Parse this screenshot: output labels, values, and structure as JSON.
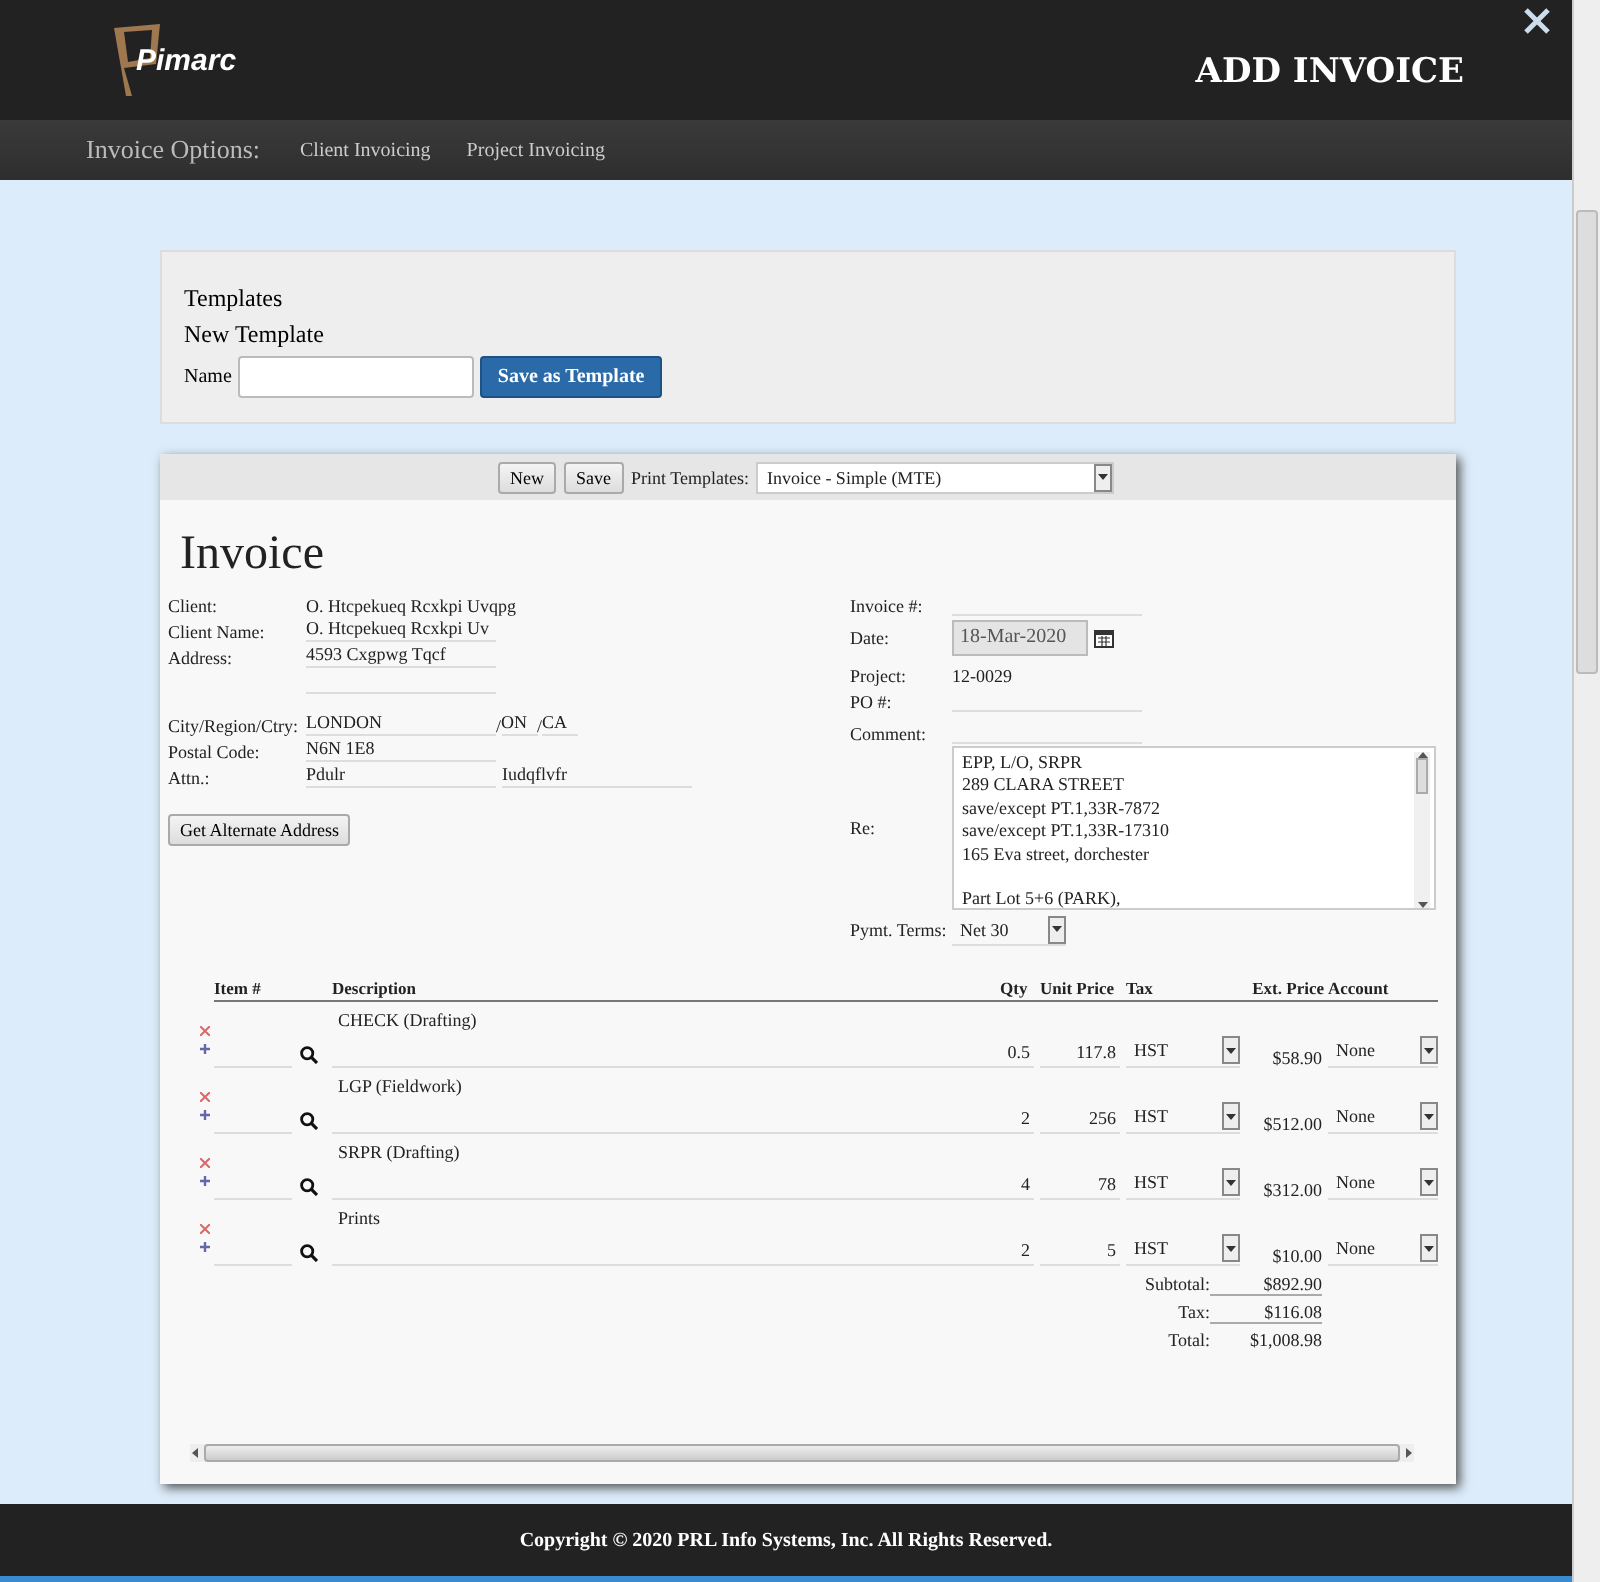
{
  "header": {
    "logo_text": "Pimarc",
    "title": "ADD INVOICE"
  },
  "nav": {
    "label": "Invoice Options:",
    "links": [
      "Client Invoicing",
      "Project Invoicing"
    ]
  },
  "templates": {
    "heading": "Templates",
    "subheading": "New Template",
    "name_label": "Name",
    "save_button": "Save as Template"
  },
  "toolbar": {
    "buttons": [
      "New",
      "Save"
    ],
    "print_label": "Print Templates:",
    "print_value": "Invoice - Simple (MTE)"
  },
  "invoice": {
    "title": "Invoice",
    "client": {
      "label": "Client:",
      "value": "O. Htcpekueq Rcxkpi Uvqpg"
    },
    "client_name": {
      "label": "Client Name:",
      "value": "O. Htcpekueq Rcxkpi Uv"
    },
    "address": {
      "label": "Address:",
      "value": "4593 Cxgpwg Tqcf"
    },
    "city": {
      "label": "City/Region/Ctry:",
      "value": "LONDON",
      "region_sep": "/",
      "region": "ON",
      "country_sep": "/",
      "country": "CA"
    },
    "postal": {
      "label": "Postal Code:",
      "value": "N6N 1E8"
    },
    "attn": {
      "label": "Attn.:",
      "first": "Pdulr",
      "last": "Iudqflvfr"
    },
    "alt_button": "Get Alternate Address",
    "invoice_no": {
      "label": "Invoice #:"
    },
    "date": {
      "label": "Date:",
      "value": "18-Mar-2020",
      "disabled": true
    },
    "project": {
      "label": "Project:",
      "value": "12-0029"
    },
    "po": {
      "label": "PO #:"
    },
    "comment": {
      "label": "Comment:"
    },
    "re": {
      "label": "Re:",
      "paragraphs": [
        [
          "EPP, L/O, SRPR",
          "289 CLARA STREET",
          "save/except PT.1,33R-7872",
          "save/except PT.1,33R-17310",
          "165 Eva street, dorchester"
        ],
        [
          "Part Lot 5+6 (PARK),"
        ]
      ]
    },
    "terms": {
      "label": "Pymt. Terms:",
      "value": "Net 30"
    }
  },
  "items": {
    "columns": [
      "Item #",
      "Description",
      "Qty",
      "Unit Price",
      "Tax",
      "Ext. Price",
      "Account"
    ],
    "rows": [
      {
        "description": "CHECK  (Drafting)",
        "qty": "0.5",
        "unit_price": "117.8",
        "tax": "HST",
        "ext_price": "$58.90",
        "account": "None"
      },
      {
        "description": "LGP (Fieldwork)",
        "qty": "2",
        "unit_price": "256",
        "tax": "HST",
        "ext_price": "$512.00",
        "account": "None"
      },
      {
        "description": "SRPR (Drafting)",
        "qty": "4",
        "unit_price": "78",
        "tax": "HST",
        "ext_price": "$312.00",
        "account": "None"
      },
      {
        "description": "Prints",
        "qty": "2",
        "unit_price": "5",
        "tax": "HST",
        "ext_price": "$10.00",
        "account": "None"
      }
    ],
    "totals": [
      {
        "label": "Subtotal:",
        "value": "$892.90"
      },
      {
        "label": "Tax:",
        "value": "$116.08"
      },
      {
        "label": "Total:",
        "value": "$1,008.98"
      }
    ]
  },
  "footer": {
    "copyright": "Copyright © 2020 PRL Info Systems, Inc. All Rights Reserved."
  }
}
